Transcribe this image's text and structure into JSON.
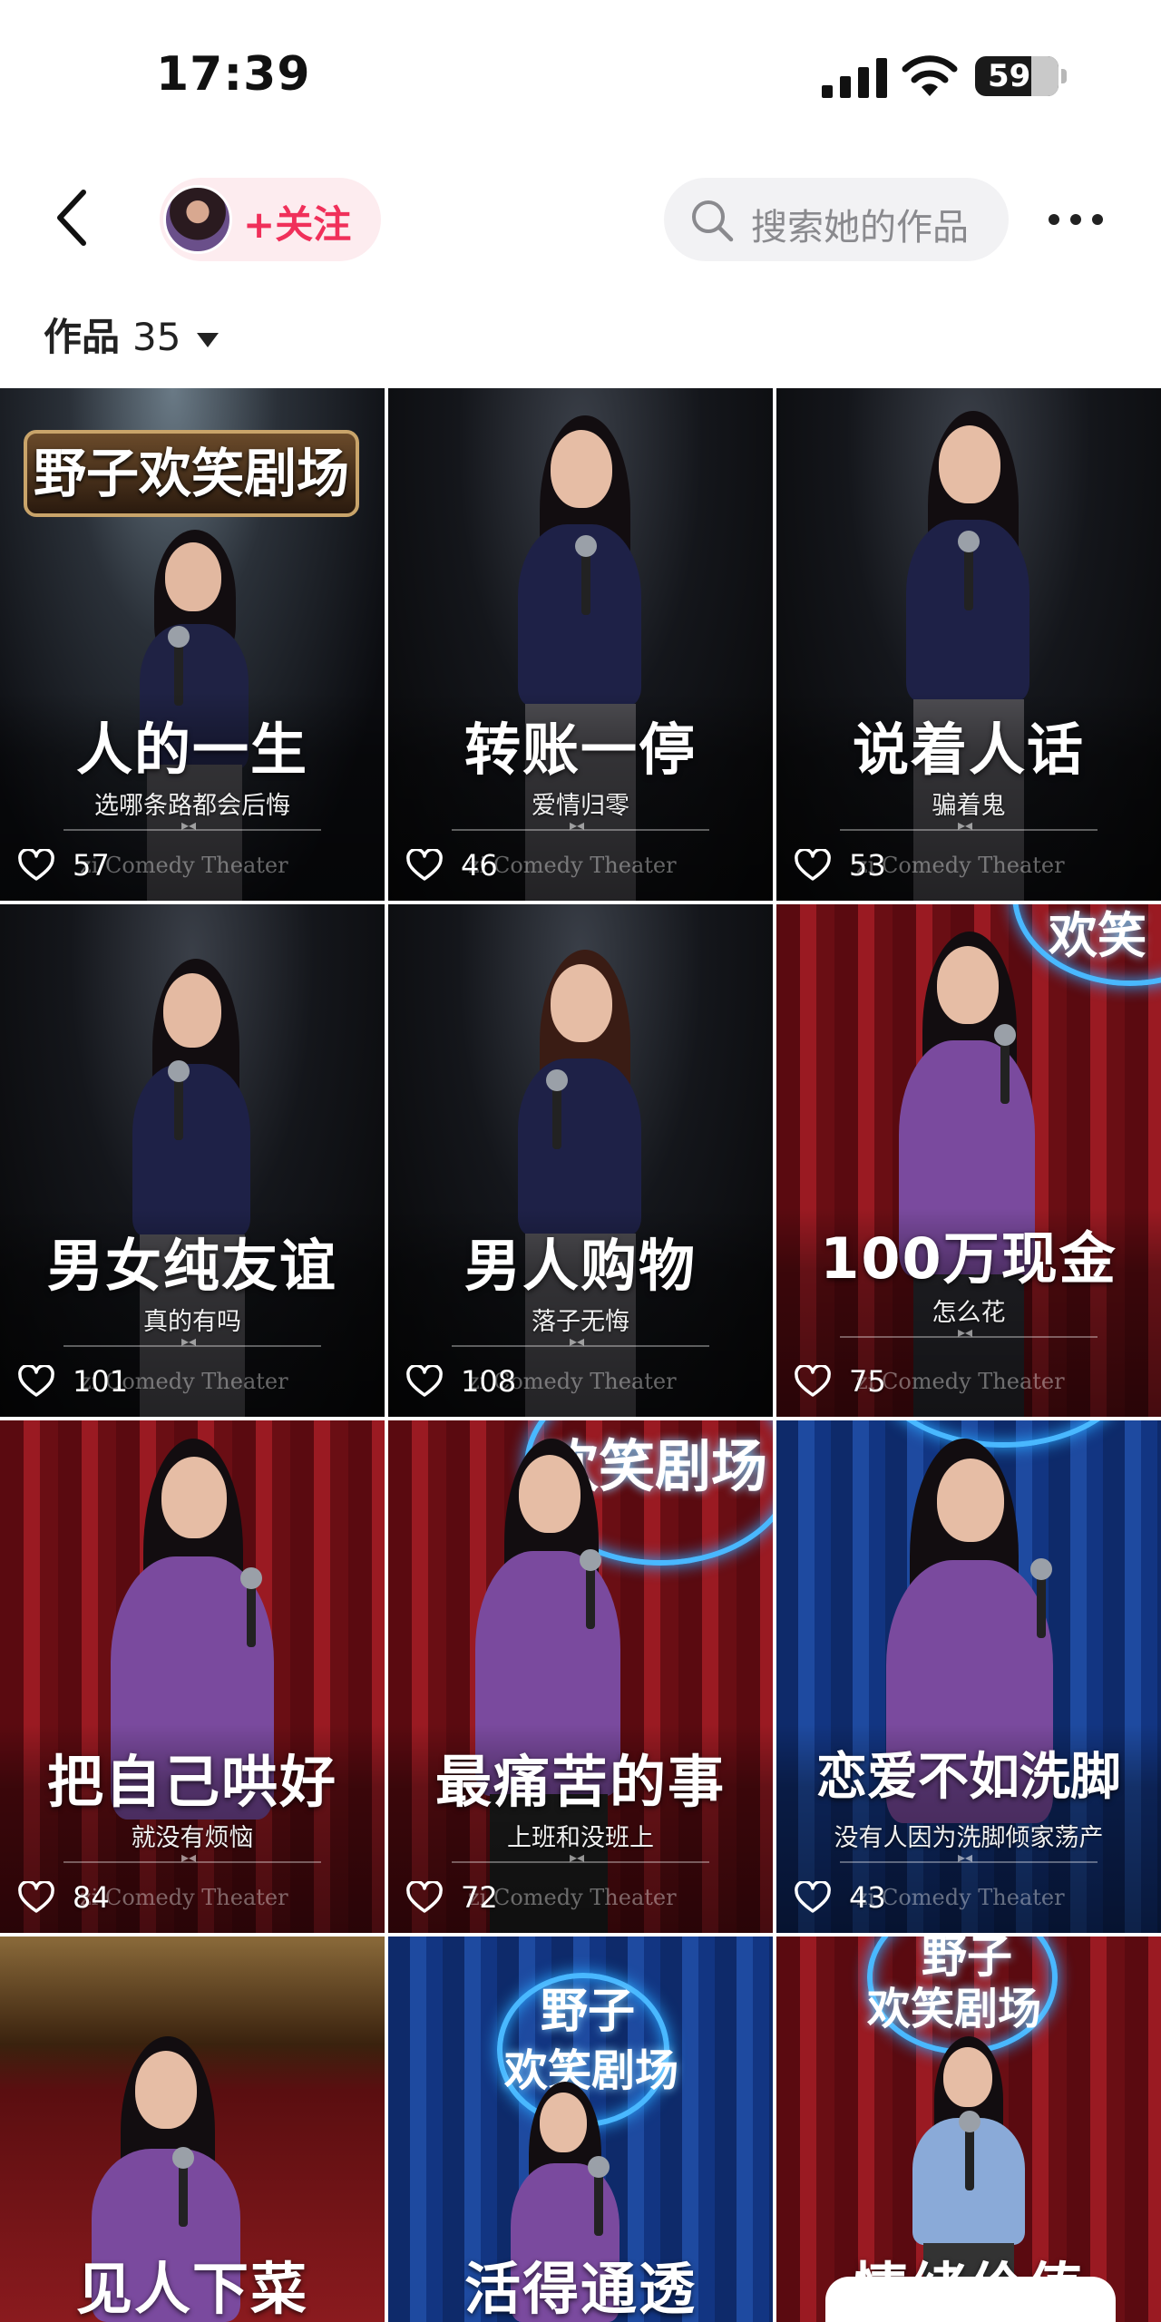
{
  "status_bar": {
    "time": "17:39",
    "battery": "59"
  },
  "nav": {
    "follow_label": "+关注",
    "search_placeholder": "搜索她的作品"
  },
  "works": {
    "label": "作品",
    "count": "35"
  },
  "tiles": [
    {
      "title": "人的一生",
      "subtitle": "选哪条路都会后悔",
      "likes": "57",
      "sign": "野子欢笑剧场",
      "watermark": "zi Comedy Theater"
    },
    {
      "title": "转账一停",
      "subtitle": "爱情归零",
      "likes": "46",
      "watermark": "zi Comedy Theater"
    },
    {
      "title": "说着人话",
      "subtitle": "骗着鬼",
      "likes": "53",
      "watermark": "zi Comedy Theater"
    },
    {
      "title": "男女纯友谊",
      "subtitle": "真的有吗",
      "likes": "101",
      "watermark": "zi Comedy Theater"
    },
    {
      "title": "男人购物",
      "subtitle": "落子无悔",
      "likes": "108",
      "watermark": "zi Comedy Theater"
    },
    {
      "title": "100万现金",
      "subtitle": "怎么花",
      "likes": "75",
      "neon": "欢笑",
      "watermark": "zi Comedy Theater"
    },
    {
      "title": "把自己哄好",
      "subtitle": "就没有烦恼",
      "likes": "84",
      "watermark": "zi Comedy Theater"
    },
    {
      "title": "最痛苦的事",
      "subtitle": "上班和没班上",
      "likes": "72",
      "neon": "欢笑剧场",
      "watermark": "zi Comedy Theater"
    },
    {
      "title": "恋爱不如洗脚",
      "subtitle": "没有人因为洗脚倾家荡产",
      "likes": "43",
      "watermark": "zi Comedy Theater"
    },
    {
      "title": "见人下菜"
    },
    {
      "title": "活得通透",
      "neon_line1": "野子",
      "neon_line2": "欢笑剧场"
    },
    {
      "title": "情绪价值",
      "neon_line1": "野子",
      "neon_line2": "欢笑剧场"
    }
  ],
  "colors": {
    "accent": "#f0305a",
    "follow_bg": "#fdecef",
    "search_bg": "#f2f2f4"
  },
  "icons": [
    "back-arrow-icon",
    "search-icon",
    "more-dots-icon",
    "heart-icon",
    "signal-icon",
    "wifi-icon",
    "battery-icon",
    "caret-down-icon"
  ]
}
